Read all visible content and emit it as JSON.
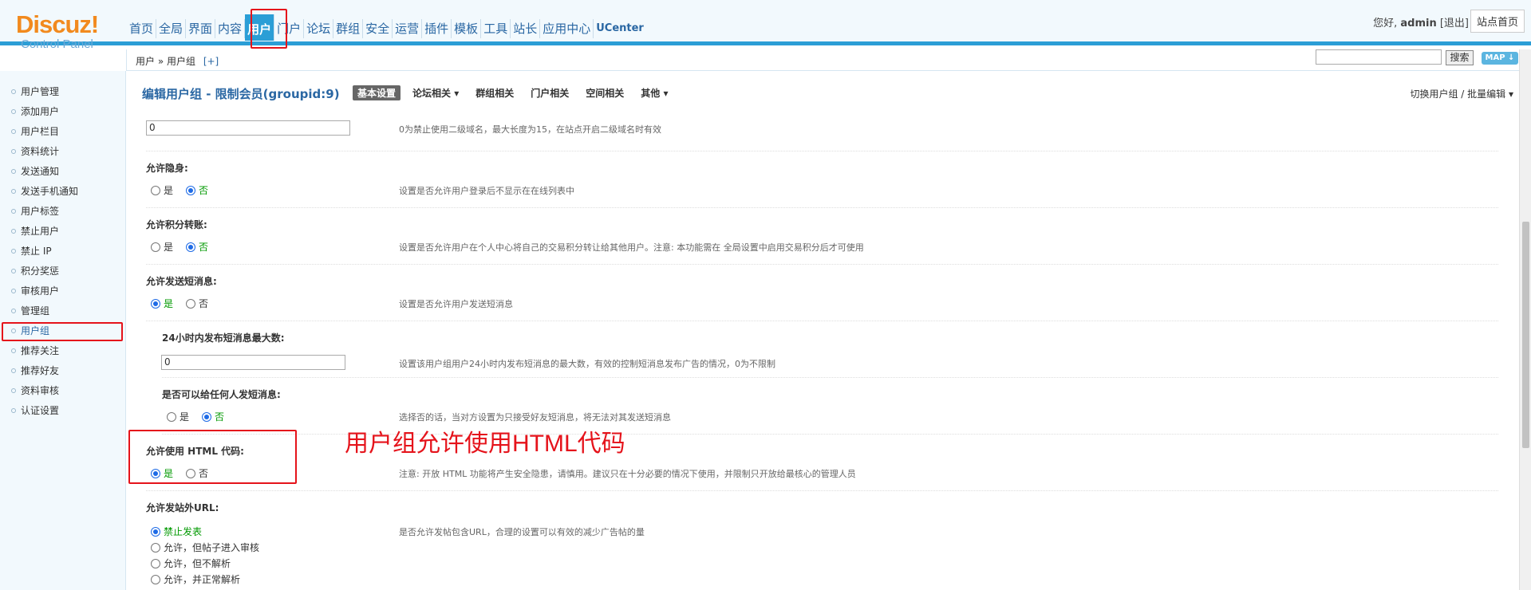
{
  "header": {
    "logo_brand": "Discuz!",
    "logo_sub": "Control Panel",
    "nav": [
      "首页",
      "全局",
      "界面",
      "内容",
      "用户",
      "门户",
      "论坛",
      "群组",
      "安全",
      "运营",
      "插件",
      "模板",
      "工具",
      "站长",
      "应用中心",
      "UCenter"
    ],
    "active_nav": "用户",
    "greeting": "您好,",
    "username": "admin",
    "logout": "[退出]",
    "site_home": "站点首页"
  },
  "subbar": {
    "breadcrumb": "用户 » 用户组",
    "add": "[+]",
    "search_button": "搜索",
    "map_button": "MAP ↓"
  },
  "sidebar": {
    "items": [
      "用户管理",
      "添加用户",
      "用户栏目",
      "资料统计",
      "发送通知",
      "发送手机通知",
      "用户标签",
      "禁止用户",
      "禁止 IP",
      "积分奖惩",
      "审核用户",
      "管理组",
      "用户组",
      "推荐关注",
      "推荐好友",
      "资料审核",
      "认证设置"
    ],
    "active": "用户组"
  },
  "main": {
    "title": "编辑用户组 - 限制会员(groupid:9)",
    "tabs": [
      "基本设置",
      "论坛相关 ▾",
      "群组相关",
      "门户相关",
      "空间相关",
      "其他 ▾"
    ],
    "switch_group": "切换用户组 / 批量编辑 ▾",
    "rows": {
      "domain": {
        "value": "0",
        "desc": "0为禁止使用二级域名，最大长度为15，在站点开启二级域名时有效"
      },
      "invisible": {
        "label": "允许隐身:",
        "yes": "是",
        "no": "否",
        "selected": "否",
        "desc": "设置是否允许用户登录后不显示在在线列表中"
      },
      "transfer": {
        "label": "允许积分转账:",
        "yes": "是",
        "no": "否",
        "selected": "否",
        "desc": "设置是否允许用户在个人中心将自己的交易积分转让给其他用户。注意: 本功能需在 全局设置中启用交易积分后才可使用"
      },
      "pm": {
        "label": "允许发送短消息:",
        "yes": "是",
        "no": "否",
        "selected": "是",
        "desc": "设置是否允许用户发送短消息"
      },
      "pm_limit": {
        "label": "24小时内发布短消息最大数:",
        "value": "0",
        "desc": "设置该用户组用户24小时内发布短消息的最大数，有效的控制短消息发布广告的情况，0为不限制"
      },
      "pm_anyone": {
        "label": "是否可以给任何人发短消息:",
        "yes": "是",
        "no": "否",
        "selected": "否",
        "desc": "选择否的话，当对方设置为只接受好友短消息，将无法对其发送短消息"
      },
      "html": {
        "label": "允许使用 HTML 代码:",
        "yes": "是",
        "no": "否",
        "selected": "是",
        "desc": "注意: 开放 HTML 功能将产生安全隐患，请慎用。建议只在十分必要的情况下使用，并限制只开放给最核心的管理人员"
      },
      "url": {
        "label": "允许发站外URL:",
        "options": [
          "禁止发表",
          "允许，但帖子进入审核",
          "允许，但不解析",
          "允许，并正常解析"
        ],
        "selected": "禁止发表",
        "desc": "是否允许发帖包含URL，合理的设置可以有效的减少广告帖的量"
      }
    },
    "annotation": "用户组允许使用HTML代码"
  },
  "colors": {
    "accent": "#2b9ed6",
    "highlight": "#e5131b",
    "checked_text": "#009900",
    "link": "#2a67a3"
  }
}
